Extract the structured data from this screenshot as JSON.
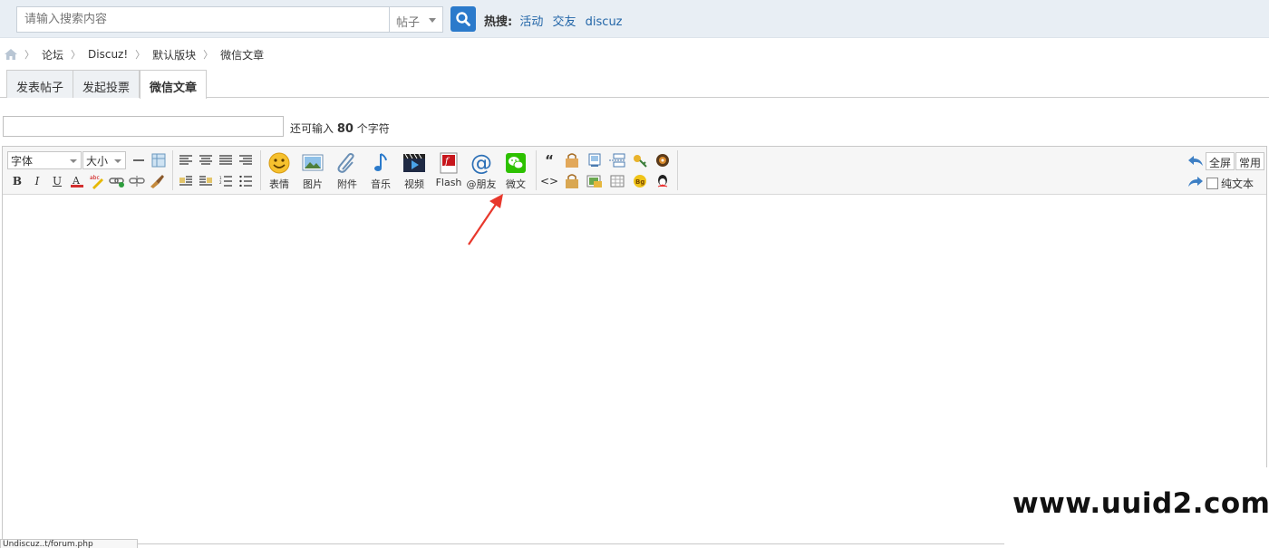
{
  "search": {
    "placeholder": "请输入搜索内容",
    "type_selected": "帖子",
    "hot_label": "热搜:",
    "hot_terms": [
      "活动",
      "交友",
      "discuz"
    ]
  },
  "breadcrumb": [
    "论坛",
    "Discuz!",
    "默认版块",
    "微信文章"
  ],
  "tabs": [
    {
      "label": "发表帖子",
      "active": false
    },
    {
      "label": "发起投票",
      "active": false
    },
    {
      "label": "微信文章",
      "active": true
    }
  ],
  "title_counter": {
    "prefix": "还可输入",
    "count": "80",
    "suffix": "个字符"
  },
  "toolbar": {
    "font_select": "字体",
    "size_select": "大小",
    "format_buttons": [
      "B",
      "I",
      "U"
    ],
    "insert_buttons": [
      {
        "label": "表情",
        "icon": "smiley-icon"
      },
      {
        "label": "图片",
        "icon": "image-icon"
      },
      {
        "label": "附件",
        "icon": "paperclip-icon"
      },
      {
        "label": "音乐",
        "icon": "music-note-icon"
      },
      {
        "label": "视频",
        "icon": "video-icon"
      },
      {
        "label": "Flash",
        "icon": "flash-icon"
      },
      {
        "label": "@朋友",
        "icon": "at-icon"
      },
      {
        "label": "微文",
        "icon": "wechat-icon"
      }
    ],
    "quote_glyph": "“",
    "code_glyph": "<>",
    "fullscreen_label": "全屏",
    "common_label": "常用",
    "plaintext_label": "纯文本"
  },
  "status_text": "Undiscuz..t/forum.php",
  "watermark": "www.uuid2.com",
  "colors": {
    "accent": "#2b7acb",
    "link": "#2366a8",
    "arrow": "#e8382c",
    "wechat": "#2dc100"
  }
}
